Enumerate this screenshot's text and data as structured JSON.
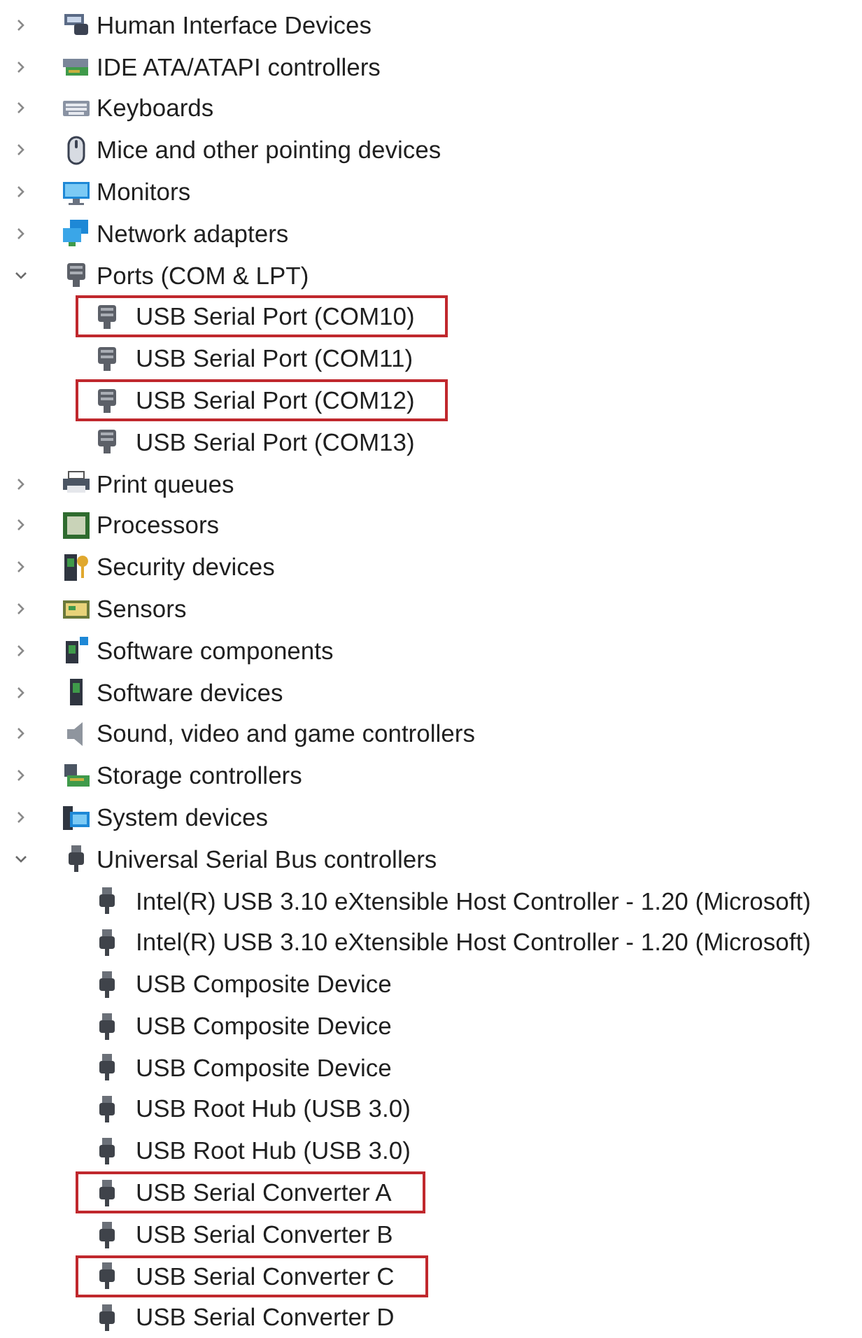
{
  "items": [
    {
      "label": "Human Interface Devices",
      "kind": "hid",
      "expanded": false
    },
    {
      "label": "IDE ATA/ATAPI controllers",
      "kind": "ide",
      "expanded": false
    },
    {
      "label": "Keyboards",
      "kind": "keyboard",
      "expanded": false
    },
    {
      "label": "Mice and other pointing devices",
      "kind": "mouse",
      "expanded": false
    },
    {
      "label": "Monitors",
      "kind": "monitor",
      "expanded": false
    },
    {
      "label": "Network adapters",
      "kind": "network",
      "expanded": false
    },
    {
      "label": "Ports (COM & LPT)",
      "kind": "port",
      "expanded": true,
      "children": [
        {
          "label": "USB Serial Port (COM10)",
          "highlighted": true
        },
        {
          "label": "USB Serial Port (COM11)",
          "highlighted": false
        },
        {
          "label": "USB Serial Port (COM12)",
          "highlighted": true
        },
        {
          "label": "USB Serial Port (COM13)",
          "highlighted": false
        }
      ]
    },
    {
      "label": "Print queues",
      "kind": "printer",
      "expanded": false
    },
    {
      "label": "Processors",
      "kind": "chip",
      "expanded": false
    },
    {
      "label": "Security devices",
      "kind": "security",
      "expanded": false
    },
    {
      "label": "Sensors",
      "kind": "sensor",
      "expanded": false
    },
    {
      "label": "Software components",
      "kind": "component",
      "expanded": false
    },
    {
      "label": "Software devices",
      "kind": "tower",
      "expanded": false
    },
    {
      "label": "Sound, video and game controllers",
      "kind": "speaker",
      "expanded": false
    },
    {
      "label": "Storage controllers",
      "kind": "storage",
      "expanded": false
    },
    {
      "label": "System devices",
      "kind": "system",
      "expanded": false
    },
    {
      "label": "Universal Serial Bus controllers",
      "kind": "usb",
      "expanded": true,
      "children": [
        {
          "label": "Intel(R) USB 3.10 eXtensible Host Controller - 1.20 (Microsoft)",
          "highlighted": false
        },
        {
          "label": "Intel(R) USB 3.10 eXtensible Host Controller - 1.20 (Microsoft)",
          "highlighted": false
        },
        {
          "label": "USB Composite Device",
          "highlighted": false
        },
        {
          "label": "USB Composite Device",
          "highlighted": false
        },
        {
          "label": "USB Composite Device",
          "highlighted": false
        },
        {
          "label": "USB Root Hub (USB 3.0)",
          "highlighted": false
        },
        {
          "label": "USB Root Hub (USB 3.0)",
          "highlighted": false
        },
        {
          "label": "USB Serial Converter A",
          "highlighted": true
        },
        {
          "label": "USB Serial Converter B",
          "highlighted": false
        },
        {
          "label": "USB Serial Converter C",
          "highlighted": true
        },
        {
          "label": "USB Serial Converter D",
          "highlighted": false
        }
      ]
    }
  ]
}
